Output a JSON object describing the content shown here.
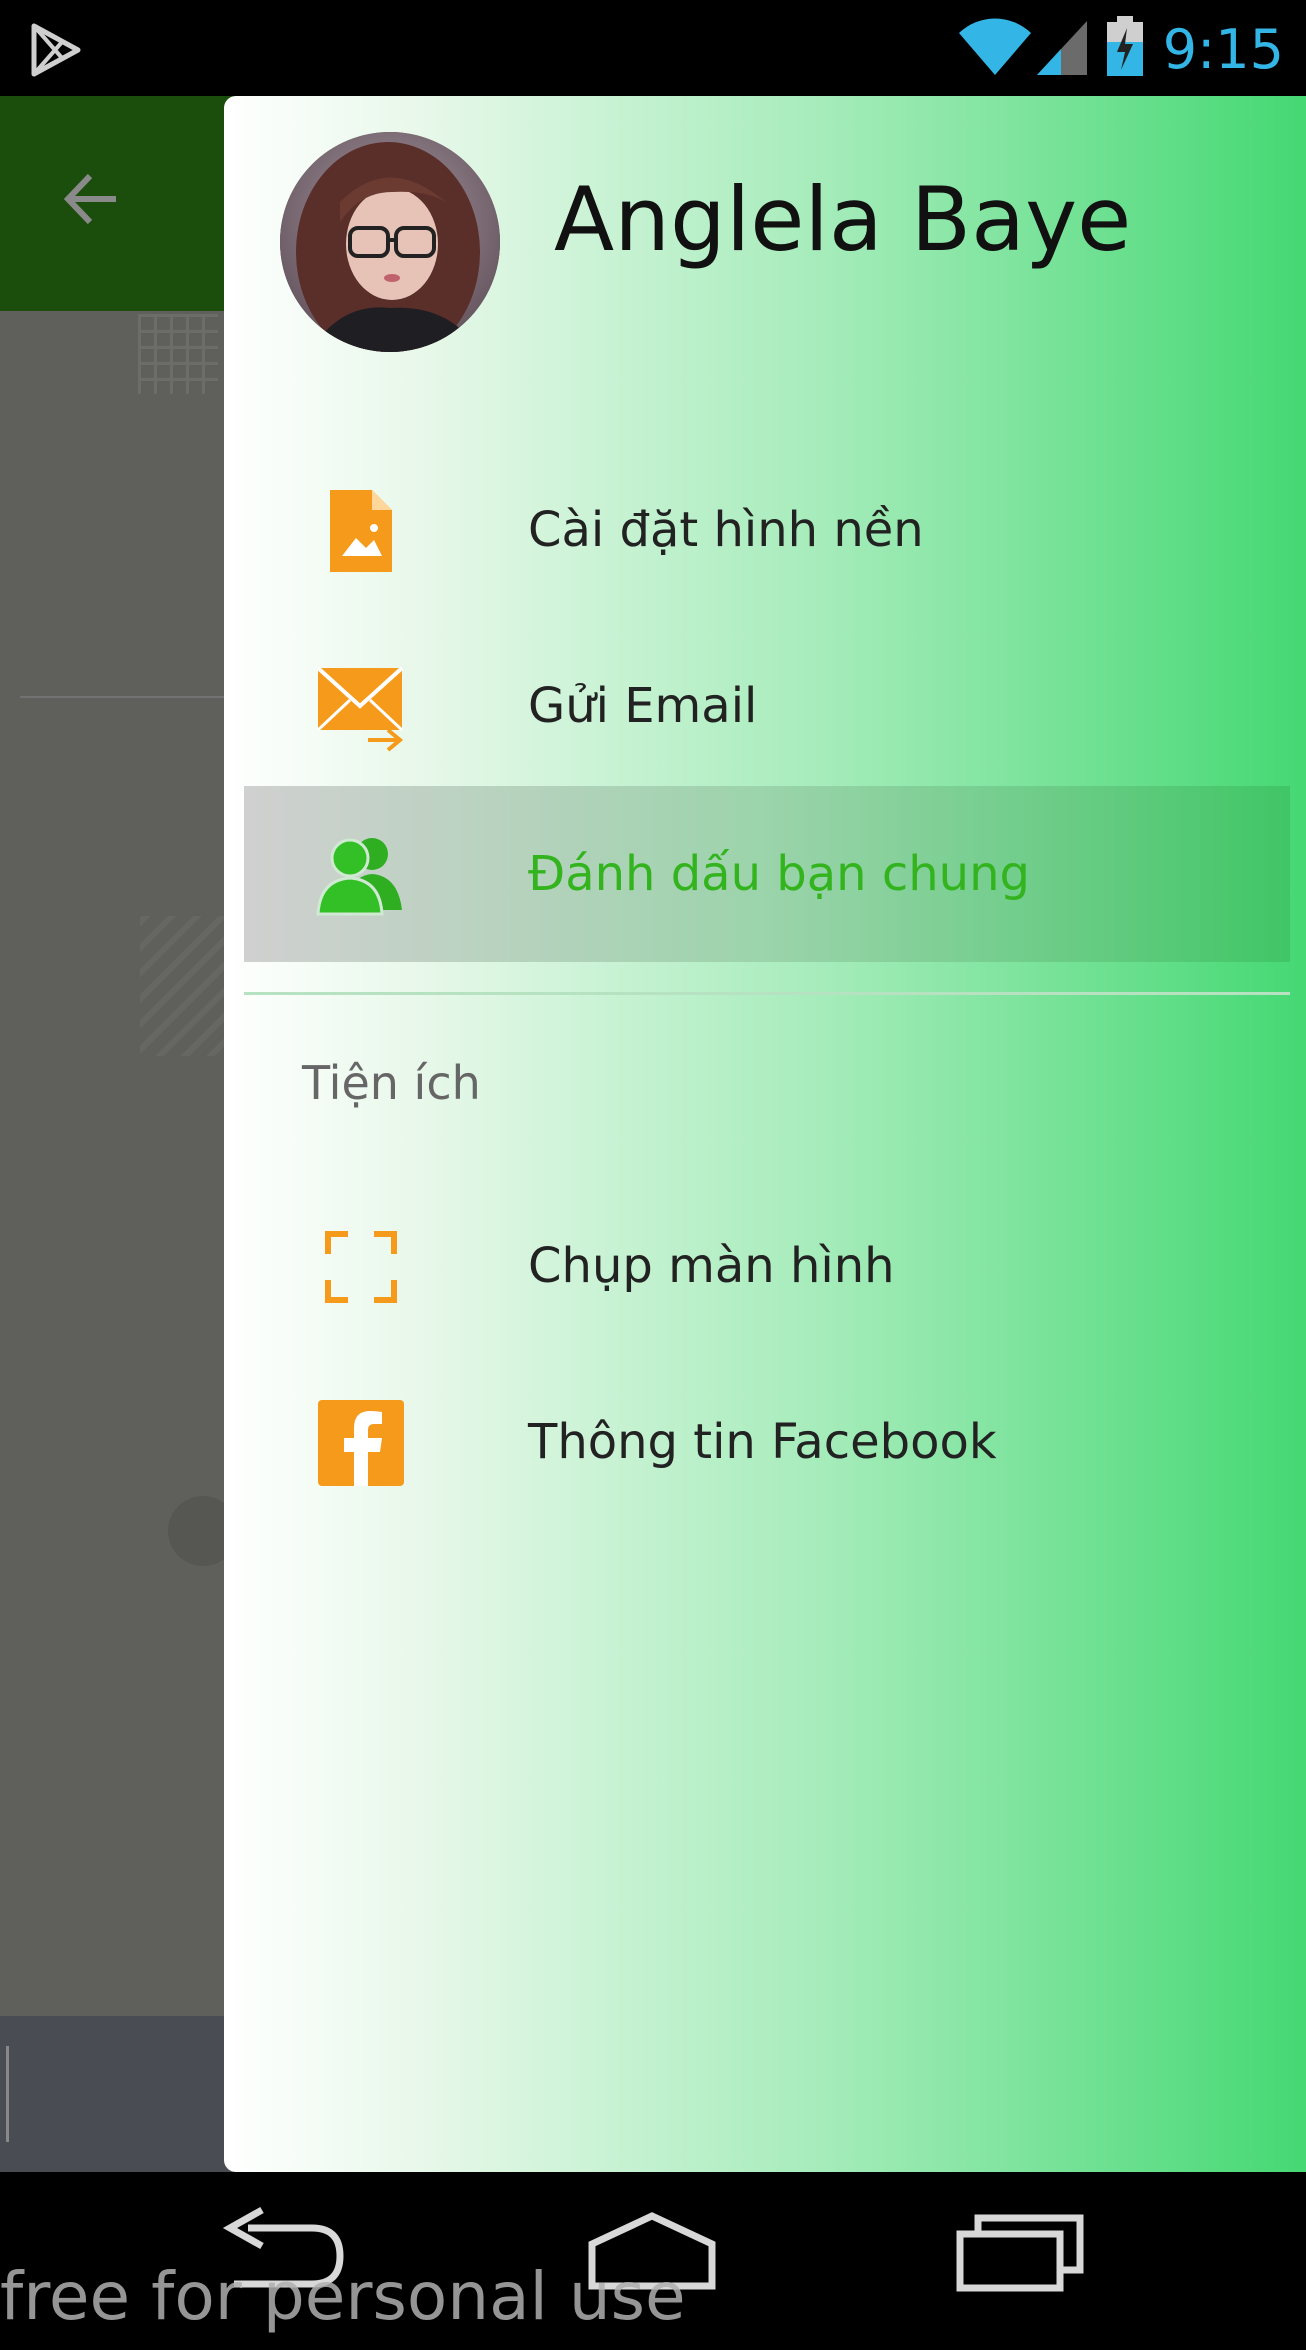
{
  "status_bar": {
    "time": "9:15",
    "icons": [
      "play-store-icon",
      "wifi-icon",
      "signal-icon",
      "battery-charging-icon"
    ],
    "time_color": "#33b5e5"
  },
  "background_app": {
    "toolbar_color": "#1b4d0c",
    "icons": [
      "back-arrow-icon"
    ]
  },
  "drawer": {
    "profile": {
      "name": "Anglela Baye"
    },
    "menu": [
      {
        "label": "Cài đặt hình nền",
        "icon": "image-file-icon"
      },
      {
        "label": "Gửi Email",
        "icon": "email-send-icon"
      },
      {
        "label": "Đánh dấu bạn chung",
        "icon": "friends-icon",
        "active": true
      }
    ],
    "section_header": "Tiện ích",
    "utilities": [
      {
        "label": "Chụp màn hình",
        "icon": "screenshot-frame-icon"
      },
      {
        "label": "Thông tin Facebook",
        "icon": "facebook-icon"
      }
    ],
    "colors": {
      "icon": "#f59a1b",
      "active_text": "#33b41f",
      "gradient_end": "#45d873"
    }
  },
  "nav_bar": {
    "icons": [
      "back-nav-icon",
      "home-nav-icon",
      "recents-nav-icon"
    ]
  },
  "watermark": "free for personal use"
}
